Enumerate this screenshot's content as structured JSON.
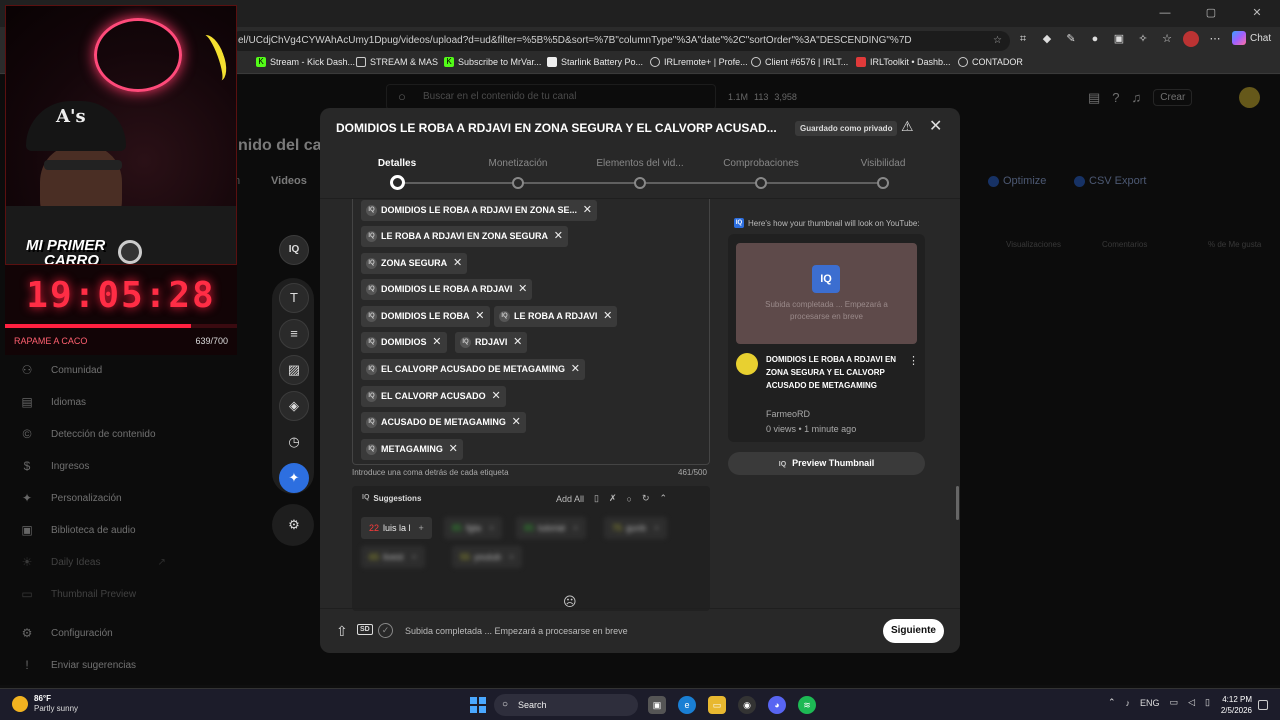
{
  "browser": {
    "url": "el/UCdjChVg4CYWAhAcUmy1Dpug/videos/upload?d=ud&filter=%5B%5D&sort=%7B\"columnType\"%3A\"date\"%2C\"sortOrder\"%3A\"DESCENDING\"%7D",
    "chat_label": "Chat",
    "bookmarks": [
      "Stream - Kick Dash...",
      "STREAM & MAS",
      "Subscribe to MrVar...",
      "Starlink Battery Po...",
      "IRLremote+ | Profe...",
      "Client #6576 | IRLT...",
      "IRLToolkit • Dashb...",
      "CONTADOR"
    ]
  },
  "studio": {
    "search_placeholder": "Buscar en el contenido de tu canal",
    "stats": [
      "1.1M",
      "113",
      "3,958"
    ],
    "crear_label": "Crear",
    "page_title": "nido del can",
    "tab_partial": "n",
    "tab_videos": "Videos",
    "optimize_label": "Optimize",
    "csv_label": "CSV Export",
    "col_views": "Visualizaciones",
    "col_comments": "Comentarios",
    "col_likes": "% de Me gusta",
    "sidebar": [
      {
        "label": "Comunidad",
        "icon": "people-icon"
      },
      {
        "label": "Idiomas",
        "icon": "subtitles-icon"
      },
      {
        "label": "Detección de contenido",
        "icon": "copyright-icon"
      },
      {
        "label": "Ingresos",
        "icon": "dollar-icon"
      },
      {
        "label": "Personalización",
        "icon": "magic-wand-icon"
      },
      {
        "label": "Biblioteca de audio",
        "icon": "audio-library-icon"
      },
      {
        "label": "Daily Ideas",
        "icon": "lightbulb-icon"
      },
      {
        "label": "Thumbnail Preview",
        "icon": "thumbnail-icon"
      },
      {
        "label": "Configuración",
        "icon": "gear-icon"
      },
      {
        "label": "Enviar sugerencias",
        "icon": "feedback-icon"
      }
    ]
  },
  "overlay": {
    "banner_line1": "MI PRIMER",
    "banner_line2": "CARRO",
    "clock": "19:05:28",
    "progress": 0.8,
    "label": "RAPAME A CACO",
    "count": "639/700"
  },
  "modal": {
    "title": "DOMIDIOS LE ROBA A RDJAVI EN ZONA SEGURA Y EL CALVORP ACUSAD...",
    "saved_badge": "Guardado como privado",
    "steps": [
      "Detalles",
      "Monetización",
      "Elementos del vid...",
      "Comprobaciones",
      "Visibilidad"
    ],
    "tags": [
      "DOMIDIOS LE ROBA A RDJAVI EN ZONA SE...",
      "LE ROBA A RDJAVI EN ZONA SEGURA",
      "ZONA SEGURA",
      "DOMIDIOS LE ROBA A RDJAVI",
      "DOMIDIOS LE ROBA",
      "LE ROBA A RDJAVI",
      "DOMIDIOS",
      "RDJAVI",
      "EL CALVORP ACUSADO DE METAGAMING",
      "EL CALVORP ACUSADO",
      "ACUSADO DE METAGAMING",
      "METAGAMING"
    ],
    "tags_hint": "Introduce una coma detrás de cada etiqueta",
    "tags_count": "461/500",
    "suggestions_title": "Suggestions",
    "add_all": "Add All",
    "suggestions": [
      {
        "score": "22",
        "text": "luis la l"
      },
      {
        "score": "85",
        "text": "fgta"
      },
      {
        "score": "85",
        "text": "tutorial"
      },
      {
        "score": "75",
        "text": "gunb"
      },
      {
        "score": "65",
        "text": "livest"
      },
      {
        "score": "55",
        "text": "youtub"
      }
    ],
    "preview_label": "Here's how your thumbnail will look on YouTube:",
    "thumb_text": "Subida completada ... Empezará a procesarse en breve",
    "video_title": "DOMIDIOS LE ROBA A RDJAVI EN ZONA SEGURA Y EL CALVORP ACUSADO DE METAGAMING",
    "channel": "FarmeoRD",
    "meta": "0 views • 1 minute ago",
    "preview_button": "Preview Thumbnail",
    "footer_status": "Subida completada ... Empezará a procesarse en breve",
    "next_label": "Siguiente"
  },
  "taskbar": {
    "temp": "86°F",
    "condition": "Partly sunny",
    "search": "Search",
    "lang": "ENG",
    "time": "4:12 PM",
    "date": "2/5/2026"
  }
}
